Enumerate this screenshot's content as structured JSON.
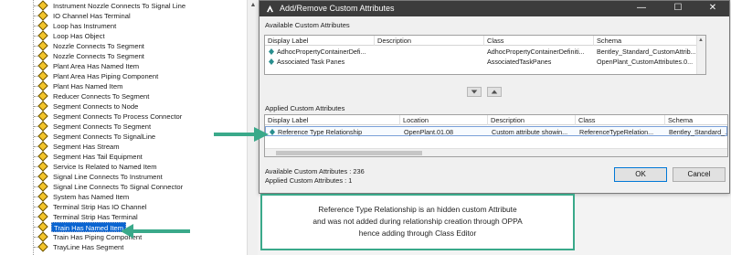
{
  "tree": {
    "items": [
      {
        "label": "Instrument Nozzle Connects To Signal Line",
        "selected": false
      },
      {
        "label": "IO Channel Has Terminal",
        "selected": false
      },
      {
        "label": "Loop has Instrument",
        "selected": false
      },
      {
        "label": "Loop Has Object",
        "selected": false
      },
      {
        "label": "Nozzle Connects To Segment",
        "selected": false
      },
      {
        "label": "Nozzle Connects To Segment",
        "selected": false
      },
      {
        "label": "Plant Area Has Named Item",
        "selected": false
      },
      {
        "label": "Plant Area Has Piping Component",
        "selected": false
      },
      {
        "label": "Plant Has Named Item",
        "selected": false
      },
      {
        "label": "Reducer Connects To Segment",
        "selected": false
      },
      {
        "label": "Segment Connects to Node",
        "selected": false
      },
      {
        "label": "Segment Connects To Process Connector",
        "selected": false
      },
      {
        "label": "Segment Connects To Segment",
        "selected": false
      },
      {
        "label": "Segment Connects To SignalLine",
        "selected": false
      },
      {
        "label": "Segment Has Stream",
        "selected": false
      },
      {
        "label": "Segment Has Tail Equipment",
        "selected": false
      },
      {
        "label": "Service Is Related to Named Item",
        "selected": false
      },
      {
        "label": "Signal Line Connects To Instrument",
        "selected": false
      },
      {
        "label": "Signal Line Connects To Signal Connector",
        "selected": false
      },
      {
        "label": "System has Named Item",
        "selected": false
      },
      {
        "label": "Terminal Strip Has IO Channel",
        "selected": false
      },
      {
        "label": "Terminal Strip Has Terminal",
        "selected": false
      },
      {
        "label": "Train Has Named Item",
        "selected": true
      },
      {
        "label": "Train Has Piping Component",
        "selected": false
      },
      {
        "label": "TrayLine Has Segment",
        "selected": false
      }
    ]
  },
  "dialog": {
    "title": "Add/Remove Custom Attributes",
    "minimize_glyph": "—",
    "maximize_glyph": "☐",
    "close_glyph": "✕",
    "available": {
      "label": "Available Custom Attributes",
      "columns": [
        "Display Label",
        "Description",
        "Class",
        "Schema"
      ],
      "rows": [
        [
          "AdhocPropertyContainerDefi...",
          "",
          "AdhocPropertyContainerDefiniti...",
          "Bentley_Standard_CustomAttrib..."
        ],
        [
          "Associated Task Panes",
          "",
          "AssociatedTaskPanes",
          "OpenPlant_CustomAttributes.0..."
        ]
      ]
    },
    "applied": {
      "label": "Applied Custom Attributes",
      "columns": [
        "Display Label",
        "Location",
        "Description",
        "Class",
        "Schema"
      ],
      "rows": [
        [
          "Reference Type Relationship",
          "OpenPlant.01.08",
          "Custom attribute showin...",
          "ReferenceTypeRelation...",
          "Bentley_Standard_..."
        ]
      ]
    },
    "counts": {
      "available": "Available Custom Attributes : 236",
      "applied": "Applied Custom Attributes : 1"
    },
    "ok_label": "OK",
    "cancel_label": "Cancel",
    "move_down_glyph": "▼",
    "move_up_glyph": "▲"
  },
  "callout": {
    "lines": [
      "Reference Type Relationship  is an hidden custom Attribute",
      "and was not added during relationship creation through OPPA",
      "hence adding through Class Editor"
    ]
  },
  "colors": {
    "arrow": "#3aa98a",
    "selection": "#0a64d1",
    "titlebar": "#3c3c3c"
  }
}
